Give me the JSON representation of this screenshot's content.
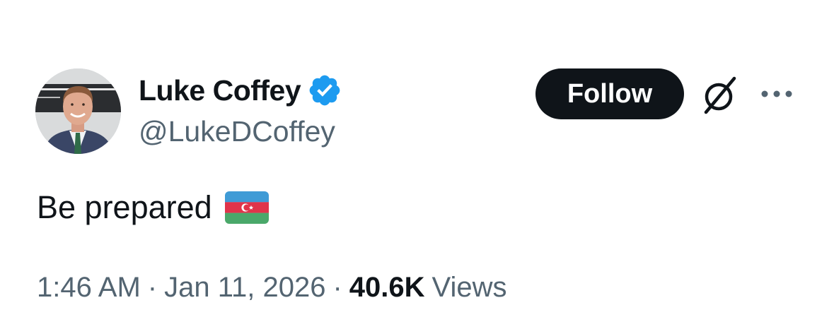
{
  "author": {
    "display_name": "Luke Coffey",
    "handle": "@LukeDCoffey",
    "verified": true,
    "verified_color": "#1d9bf0"
  },
  "actions": {
    "follow_label": "Follow",
    "grok_icon": "grok-icon",
    "more_icon": "more-icon"
  },
  "tweet": {
    "text": "Be prepared",
    "emoji": "flag-azerbaijan"
  },
  "meta": {
    "time": "1:46 AM",
    "separator": "·",
    "date": "Jan 11, 2026",
    "views_count": "40.6K",
    "views_label": "Views"
  },
  "colors": {
    "text_primary": "#0f1419",
    "text_secondary": "#536471",
    "button_bg": "#0f1419",
    "button_text": "#ffffff"
  }
}
